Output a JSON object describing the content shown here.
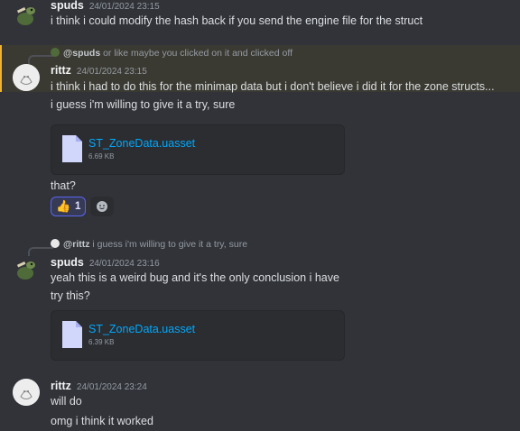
{
  "messages": {
    "m1": {
      "username": "spuds",
      "timestamp": "24/01/2024 23:15",
      "text": "i think i could modify the hash back if you send the engine file for the struct"
    },
    "m2": {
      "reply_name": "@spuds",
      "reply_text": "or like maybe you clicked on it and clicked off",
      "username": "rittz",
      "timestamp": "24/01/2024 23:15",
      "line1": "i think i had to do this for the minimap data but i don't believe i did it for the zone structs...",
      "line2": "i guess i'm willing to give it a try, sure",
      "attachment": {
        "name": "ST_ZoneData.uasset",
        "size": "6.69 KB"
      },
      "line3": "that?",
      "reaction": {
        "emoji": "👍",
        "count": "1"
      }
    },
    "m3": {
      "reply_name": "@rittz",
      "reply_text": "i guess i'm willing to give it a try, sure",
      "username": "spuds",
      "timestamp": "24/01/2024 23:16",
      "line1": "yeah this is a weird bug and it's the only conclusion i have",
      "line2": "try this?",
      "attachment": {
        "name": "ST_ZoneData.uasset",
        "size": "6.39 KB"
      }
    },
    "m4": {
      "username": "rittz",
      "timestamp": "24/01/2024 23:24",
      "line1": "will do",
      "line2": "omg i think it worked"
    }
  },
  "colors": {
    "background": "#313338",
    "link": "#00a8fc",
    "mention_highlight": "#f0b232",
    "reaction_border": "#5865f2"
  }
}
